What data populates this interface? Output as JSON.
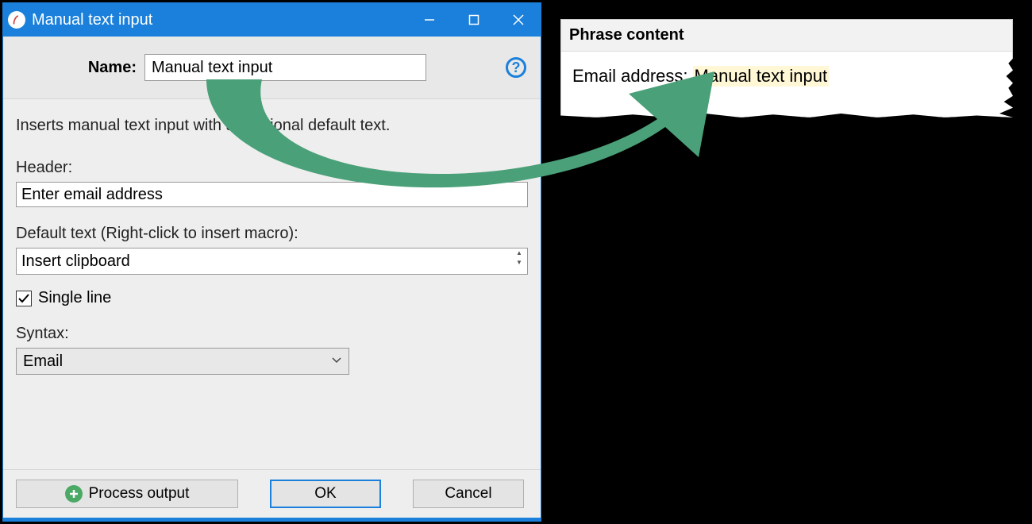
{
  "dialog": {
    "title": "Manual text input",
    "name_label": "Name:",
    "name_value": "Manual text input",
    "description": "Inserts manual text input with an optional default text.",
    "header_label": "Header:",
    "header_value": "Enter email address",
    "default_label": "Default text (Right-click to insert macro):",
    "default_value": "Insert clipboard",
    "single_line_label": "Single line",
    "single_line_checked": true,
    "syntax_label": "Syntax:",
    "syntax_value": "Email",
    "process_output_label": "Process output",
    "ok_label": "OK",
    "cancel_label": "Cancel"
  },
  "snippet": {
    "title": "Phrase content",
    "prefix": "Email address:",
    "field": "Manual text input"
  }
}
